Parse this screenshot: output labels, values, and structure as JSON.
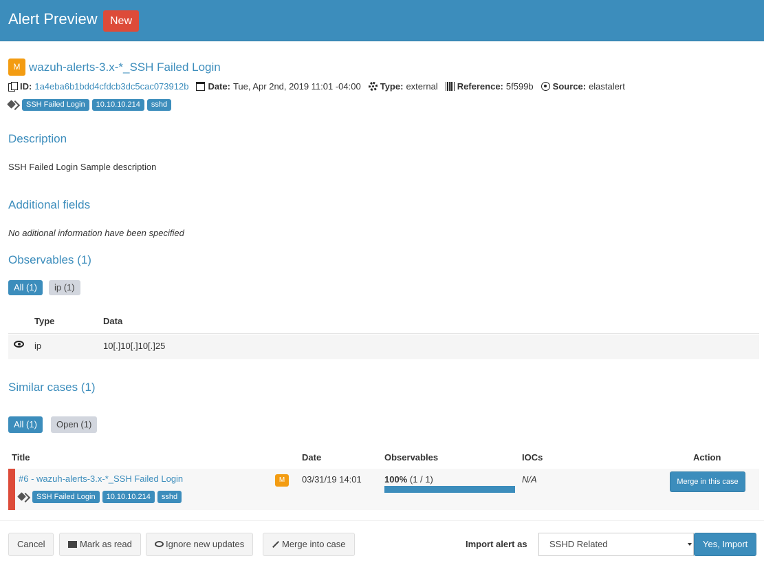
{
  "header": {
    "title": "Alert Preview",
    "badge": "New"
  },
  "alert": {
    "severity": "M",
    "title": "wazuh-alerts-3.x-*_SSH Failed Login",
    "id_label": "ID:",
    "id": "1a4eba6b1bdd4cfdcb3dc5cac073912b",
    "date_label": "Date:",
    "date": "Tue, Apr 2nd, 2019 11:01 -04:00",
    "type_label": "Type:",
    "type": "external",
    "reference_label": "Reference:",
    "reference": "5f599b",
    "source_label": "Source:",
    "source": "elastalert",
    "tags": [
      "SSH Failed Login",
      "10.10.10.214",
      "sshd"
    ]
  },
  "description": {
    "title": "Description",
    "text": "SSH Failed Login Sample description"
  },
  "additional": {
    "title": "Additional fields",
    "text": "No aditional information have been specified"
  },
  "observables": {
    "title": "Observables (1)",
    "filters": [
      "All (1)",
      "ip (1)"
    ],
    "columns": [
      "Type",
      "Data"
    ],
    "rows": [
      {
        "type": "ip",
        "data": "10[.]10[.]10[.]25"
      }
    ]
  },
  "similar": {
    "title": "Similar cases (1)",
    "filters": [
      "All (1)",
      "Open (1)"
    ],
    "columns": [
      "Title",
      "Date",
      "Observables",
      "IOCs",
      "Action"
    ],
    "rows": [
      {
        "title": "#6 - wazuh-alerts-3.x-*_SSH Failed Login",
        "severity": "M",
        "tags": [
          "SSH Failed Login",
          "10.10.10.214",
          "sshd"
        ],
        "date": "03/31/19 14:01",
        "observables_pct": "100%",
        "observables_count": "(1 / 1)",
        "observables_fraction": 1.0,
        "iocs": "N/A",
        "action": "Merge in this case"
      }
    ]
  },
  "footer": {
    "cancel": "Cancel",
    "mark_read": "Mark as read",
    "ignore_updates": "Ignore new updates",
    "merge_case": "Merge into case",
    "import_label": "Import alert as",
    "import_value": "SSHD Related",
    "yes_import": "Yes, Import"
  },
  "colors": {
    "primary": "#3c8dbc",
    "danger": "#dd4b39",
    "warning": "#f39c12"
  },
  "icons": [
    "copy-icon",
    "calendar-icon",
    "gear-icon",
    "barcode-icon",
    "target-icon",
    "tags-icon",
    "eye-icon",
    "envelope-icon",
    "compress-icon"
  ]
}
